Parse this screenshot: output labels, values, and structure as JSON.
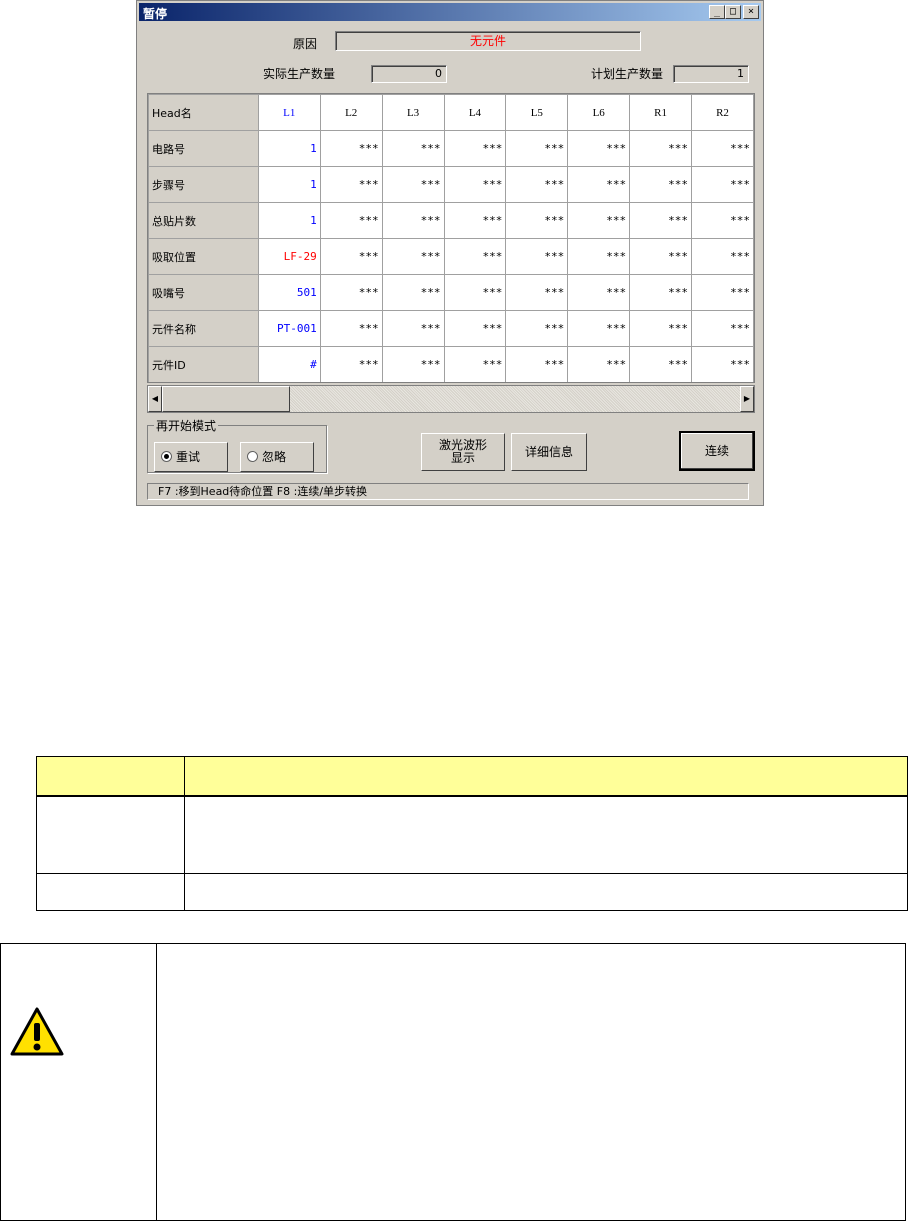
{
  "window": {
    "title": "暂停",
    "controls": {
      "minimize": "_",
      "maximize": "□",
      "close": "×"
    }
  },
  "reason": {
    "label": "原因",
    "value": "无元件"
  },
  "actual_qty": {
    "label": "实际生产数量",
    "value": "0"
  },
  "planned_qty": {
    "label": "计划生产数量",
    "value": "1"
  },
  "grid": {
    "corner": "Head名",
    "columns": [
      "L1",
      "L2",
      "L3",
      "L4",
      "L5",
      "L6",
      "R1",
      "R2"
    ],
    "rows": [
      {
        "label": "电路号",
        "values": [
          "1",
          "***",
          "***",
          "***",
          "***",
          "***",
          "***",
          "***"
        ]
      },
      {
        "label": "步骤号",
        "values": [
          "1",
          "***",
          "***",
          "***",
          "***",
          "***",
          "***",
          "***"
        ]
      },
      {
        "label": "总贴片数",
        "values": [
          "1",
          "***",
          "***",
          "***",
          "***",
          "***",
          "***",
          "***"
        ]
      },
      {
        "label": "吸取位置",
        "values": [
          "LF-29",
          "***",
          "***",
          "***",
          "***",
          "***",
          "***",
          "***"
        ]
      },
      {
        "label": "吸嘴号",
        "values": [
          "501",
          "***",
          "***",
          "***",
          "***",
          "***",
          "***",
          "***"
        ]
      },
      {
        "label": "元件名称",
        "values": [
          "PT-001",
          "***",
          "***",
          "***",
          "***",
          "***",
          "***",
          "***"
        ]
      },
      {
        "label": "元件ID",
        "values": [
          "#",
          "***",
          "***",
          "***",
          "***",
          "***",
          "***",
          "***"
        ]
      }
    ]
  },
  "restart_mode": {
    "legend": "再开始模式",
    "options": [
      {
        "label": "重试",
        "selected": true
      },
      {
        "label": "忽略",
        "selected": false
      }
    ]
  },
  "buttons": {
    "laser": [
      "激光波形",
      "显示"
    ],
    "details": "详细信息",
    "continue": "连续"
  },
  "status": "F7 :移到Head待命位置   F8 :连续/单步转换",
  "colors": {
    "reason_text": "#ff0000",
    "l1_text": "#0000ff",
    "pick_text": "#ff0000",
    "table_header": "#ffff99"
  },
  "icons": {
    "caution": "warning-triangle-icon"
  }
}
